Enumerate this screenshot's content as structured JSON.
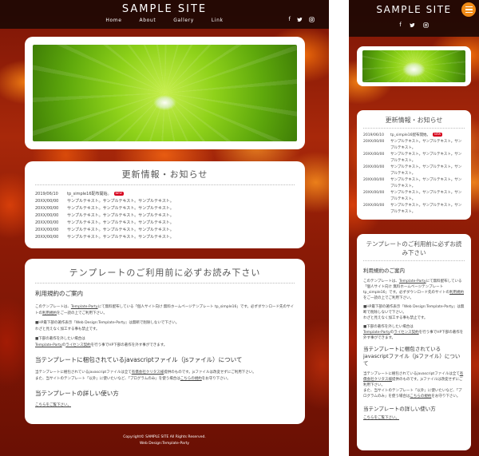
{
  "site": {
    "title": "SAMPLE SITE",
    "nav": [
      "Home",
      "About",
      "Gallery",
      "Link"
    ],
    "sns": [
      "f",
      "🐦",
      "◎"
    ]
  },
  "icons": {
    "facebook": "facebook-icon",
    "twitter": "twitter-icon",
    "instagram": "instagram-icon",
    "menu": "hamburger-menu-icon"
  },
  "colors": {
    "header_bg": "#190804",
    "new_badge": "#d6001c",
    "warning_text": "#d12a00",
    "menu_button": "#f08a17"
  },
  "news": {
    "title": "更新情報・お知らせ",
    "new_label": "NEW",
    "items": [
      {
        "date": "2019/06/10",
        "text": "tp_simple16配布開始。",
        "new": true
      },
      {
        "date": "20XX/00/00",
        "text": "サンプルテキスト。サンプルテキスト。サンプルテキスト。"
      },
      {
        "date": "20XX/00/00",
        "text": "サンプルテキスト。サンプルテキスト。サンプルテキスト。"
      },
      {
        "date": "20XX/00/00",
        "text": "サンプルテキスト。サンプルテキスト。サンプルテキスト。"
      },
      {
        "date": "20XX/00/00",
        "text": "サンプルテキスト。サンプルテキスト。サンプルテキスト。"
      },
      {
        "date": "20XX/00/00",
        "text": "サンプルテキスト。サンプルテキスト。サンプルテキスト。"
      },
      {
        "date": "20XX/00/00",
        "text": "サンプルテキスト。サンプルテキスト。サンプルテキスト。"
      }
    ]
  },
  "terms": {
    "title": "テンプレートのご利用前に必ずお読み下さい",
    "h_rules": "利用規約のご案内",
    "p1_a": "このテンプレートは、",
    "p1_link1": "Template-Party",
    "p1_b": "にて無料配布している「個人サイト向け 無料ホームページテンプレート tp_simple16」です。必ずダウンロード先のサイトの",
    "p1_link2": "利用規約",
    "p1_c": "をご一読の上でご利用下さい。",
    "warn1": "■HP最下部の著作表示『Web Design:Template-Party』は無断で削除しないで下さい。",
    "p2": "わざと見えなく加工する事も禁止です。",
    "warn2": "■下部の著作を外したい場合は",
    "p3_link": "Template-Party",
    "p3_a": "の",
    "p3_link2": "ライセンス契約",
    "p3_b": "を行う事でHP下部の著作を外す事ができます。",
    "h_js": "当テンプレートに梱包されているjavascriptファイル（jsファイル）について",
    "p4_a": "当テンプレートに梱包されているjavascriptファイルは全て",
    "p4_link": "有償会社クリタス様",
    "p4_b": "提供のものです。jsファイルは改変せずにご利用下さい。",
    "p5_a": "また、当サイトのテンプレート「以外」に使いたいなど、「プログラムのみ」を使う場合は",
    "p5_link": "こちらの規約",
    "p5_b": "をお守り下さい。",
    "h_usage": "当テンプレートの詳しい使い方",
    "usage_link": "こちらをご覧下さい。"
  },
  "footer": {
    "copyright": "Copyright© SAMPLE SITE All Rights Reserved.",
    "credit": "Web Design:Template-Party"
  }
}
